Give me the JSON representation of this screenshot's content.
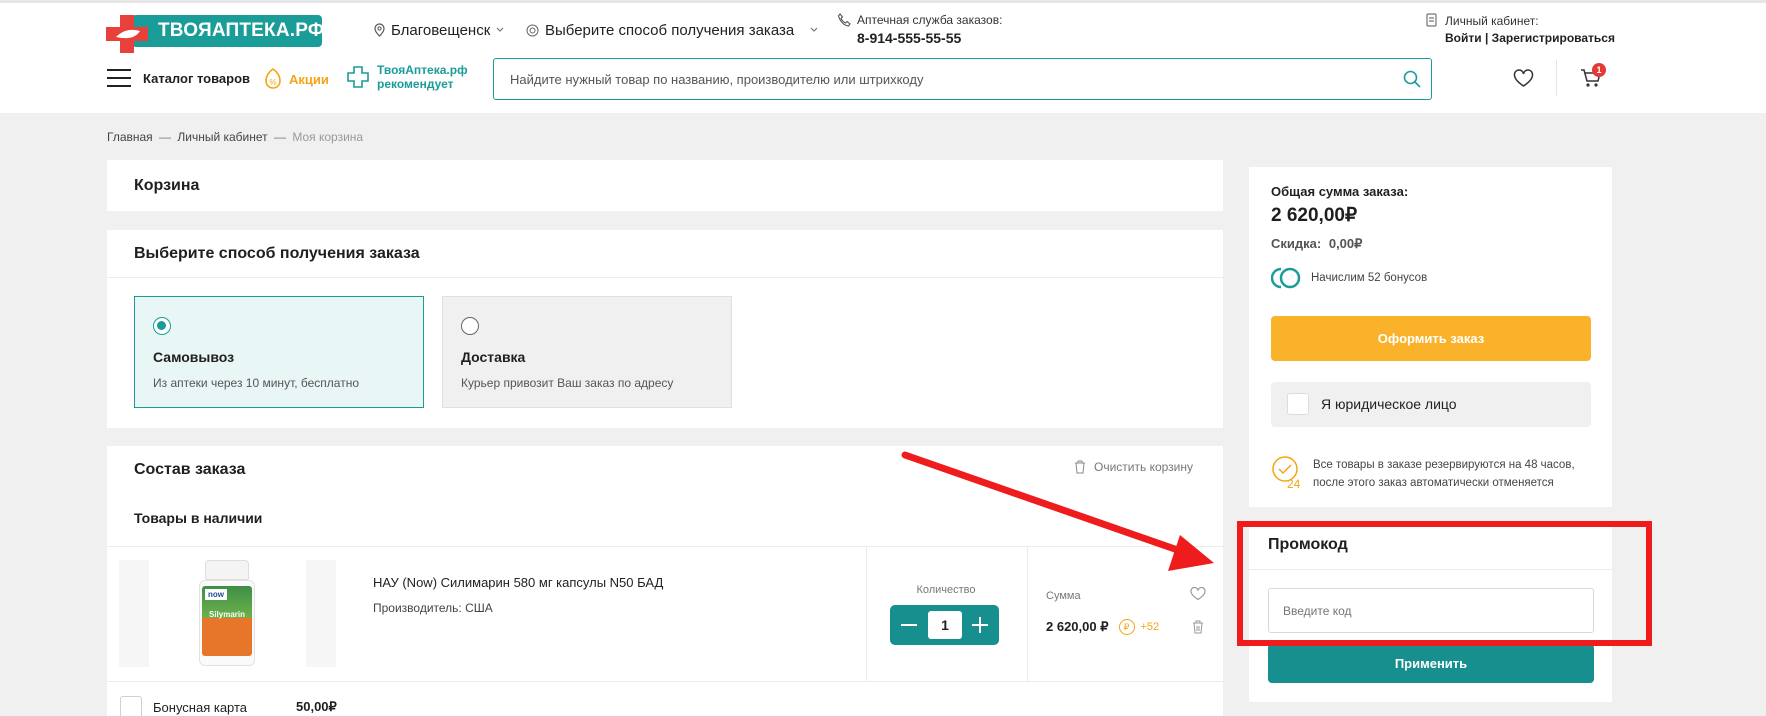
{
  "header": {
    "logo_text": "ТВОЯАПТЕКА.РФ",
    "city": "Благовещенск",
    "delivery_select": "Выберите способ получения заказа",
    "service_label": "Аптечная служба заказов:",
    "phone": "8-914-555-55-55",
    "account_label": "Личный кабинет:",
    "login": "Войти",
    "separator": " | ",
    "register": "Зарегистрироваться",
    "catalog": "Каталог товаров",
    "promo": "Акции",
    "recommend_line1": "ТвояАптека.рф",
    "recommend_line2": "рекомендует",
    "search_placeholder": "Найдите нужный товар по названию, производителю или штрихкоду",
    "cart_count": "1"
  },
  "breadcrumb": {
    "items": [
      "Главная",
      "Личный кабинет",
      "Моя корзина"
    ],
    "sep": "—"
  },
  "cart": {
    "title": "Корзина",
    "delivery_title": "Выберите способ получения заказа",
    "options": [
      {
        "title": "Самовывоз",
        "desc": "Из аптеки через 10 минут, бесплатно",
        "selected": true
      },
      {
        "title": "Доставка",
        "desc": "Курьер привозит Ваш заказ по адресу",
        "selected": false
      }
    ],
    "composition_title": "Состав заказа",
    "clear_label": "Очистить корзину",
    "available_title": "Товары в наличии",
    "item": {
      "name": "НАУ (Now) Силимарин 580 мг капсулы N50 БАД",
      "manufacturer": "Производитель: США",
      "qty_label": "Количество",
      "qty": "1",
      "sum_label": "Сумма",
      "sum": "2 620,00 ₽",
      "bonus": "+52",
      "bonus_symbol": "₽",
      "pack_brand": "now",
      "pack_name": "Silymarin"
    },
    "bonus_card_label": "Бонусная карта",
    "bonus_card_value": "50,00₽"
  },
  "summary": {
    "total_label": "Общая сумма заказа:",
    "total": "2 620,00₽",
    "discount_label": "Скидка:",
    "discount": "0,00₽",
    "bonus_note": "Начислим 52 бонусов",
    "order_button": "Оформить заказ",
    "legal_label": "Я юридическое лицо",
    "reserve_note_1": "Все товары в заказе резервируются на 48 часов,",
    "reserve_note_2": "после этого заказ автоматически отменяется",
    "promo_title": "Промокод",
    "promo_placeholder": "Введите код",
    "apply_button": "Применить"
  },
  "colors": {
    "teal": "#1a9c98",
    "orange": "#fbb22b",
    "annotation_red": "#ee1c1c"
  }
}
